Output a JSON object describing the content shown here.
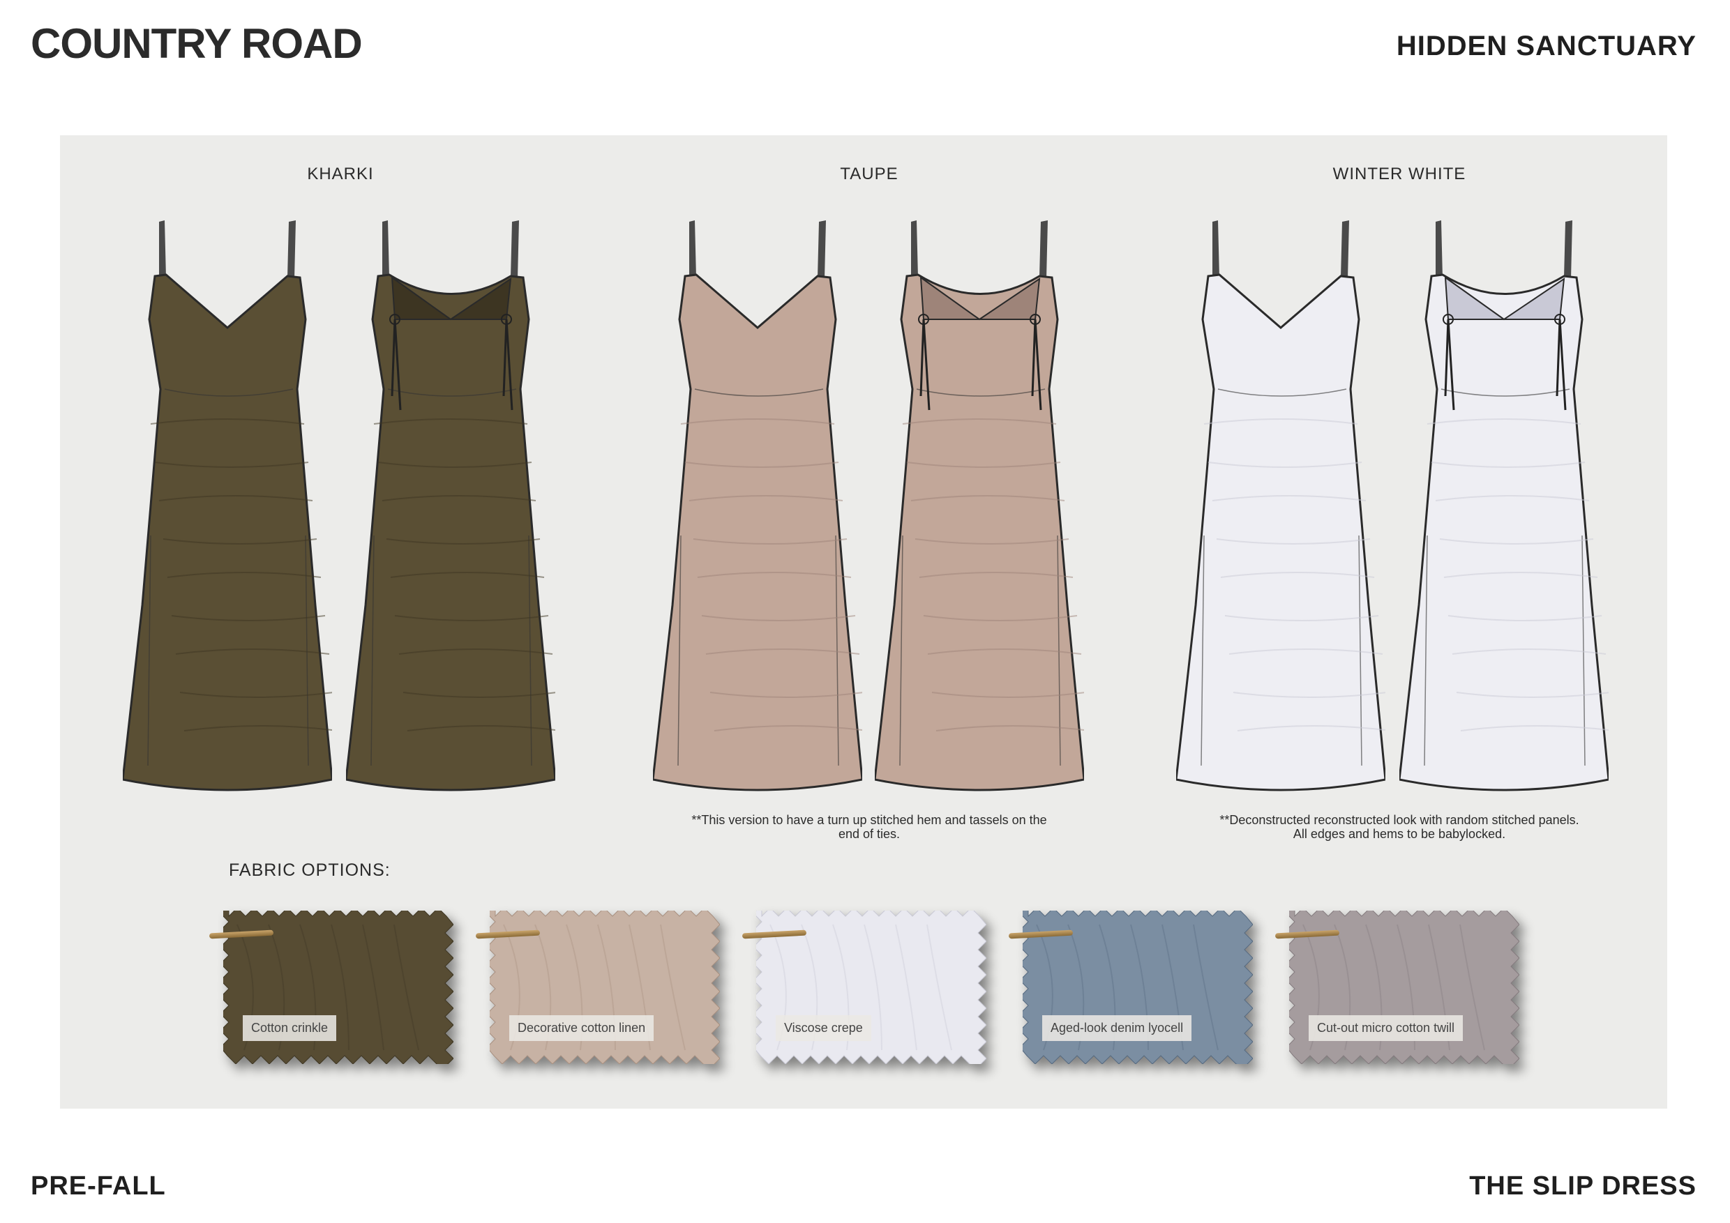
{
  "header": {
    "brand": "COUNTRY ROAD",
    "collection": "HIDDEN SANCTUARY"
  },
  "footer": {
    "season": "PRE-FALL",
    "style_name": "THE SLIP DRESS"
  },
  "colourways": [
    {
      "name": "KHARKI",
      "fill": "#5a4f34",
      "shade": "#3d3522",
      "note": ""
    },
    {
      "name": "TAUPE",
      "fill": "#c2a799",
      "shade": "#9e8479",
      "note": "**This version to have a turn up stitched hem and tassels on the end of ties."
    },
    {
      "name": "WINTER WHITE",
      "fill": "#eeeef3",
      "shade": "#c9c9d6",
      "note": "**Deconstructed reconstructed look with random stitched panels. All edges and hems to be babylocked."
    }
  ],
  "fabric": {
    "title": "FABRIC OPTIONS:",
    "swatches": [
      {
        "label": "Cotton crinkle",
        "color": "#574c33",
        "dark": "#3f3724"
      },
      {
        "label": "Decorative cotton linen",
        "color": "#c7b2a4",
        "dark": "#a89080"
      },
      {
        "label": "Viscose crepe",
        "color": "#e9e9f0",
        "dark": "#c8c8d4"
      },
      {
        "label": "Aged-look denim lyocell",
        "color": "#7b8ea2",
        "dark": "#566a80"
      },
      {
        "label": "Cut-out micro cotton twill",
        "color": "#a59c9e",
        "dark": "#847b7e"
      }
    ]
  }
}
